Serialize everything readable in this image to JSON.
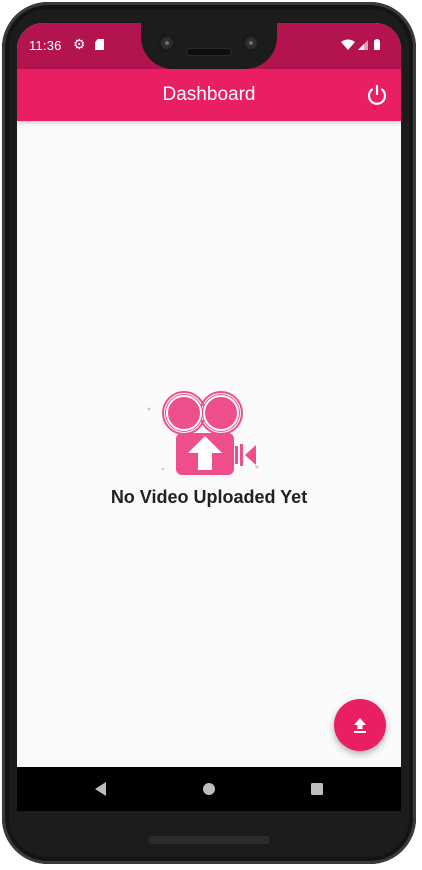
{
  "status_bar": {
    "time": "11:36",
    "icons": [
      "gear-icon",
      "sd-card-icon",
      "wifi-icon",
      "signal-icon",
      "battery-icon"
    ]
  },
  "app_bar": {
    "title": "Dashboard",
    "action_icon": "power-icon"
  },
  "empty_state": {
    "illustration": "video-camera-upload-icon",
    "message": "No Video Uploaded Yet"
  },
  "fab": {
    "icon": "upload-icon"
  },
  "nav_bar": {
    "buttons": [
      "back-icon",
      "home-icon",
      "recents-icon"
    ]
  },
  "colors": {
    "primary": "#e91e63",
    "primary_dark": "#b3134f",
    "illustration_pink": "#ee4f8c",
    "background": "#fafafa",
    "text": "#212121"
  }
}
